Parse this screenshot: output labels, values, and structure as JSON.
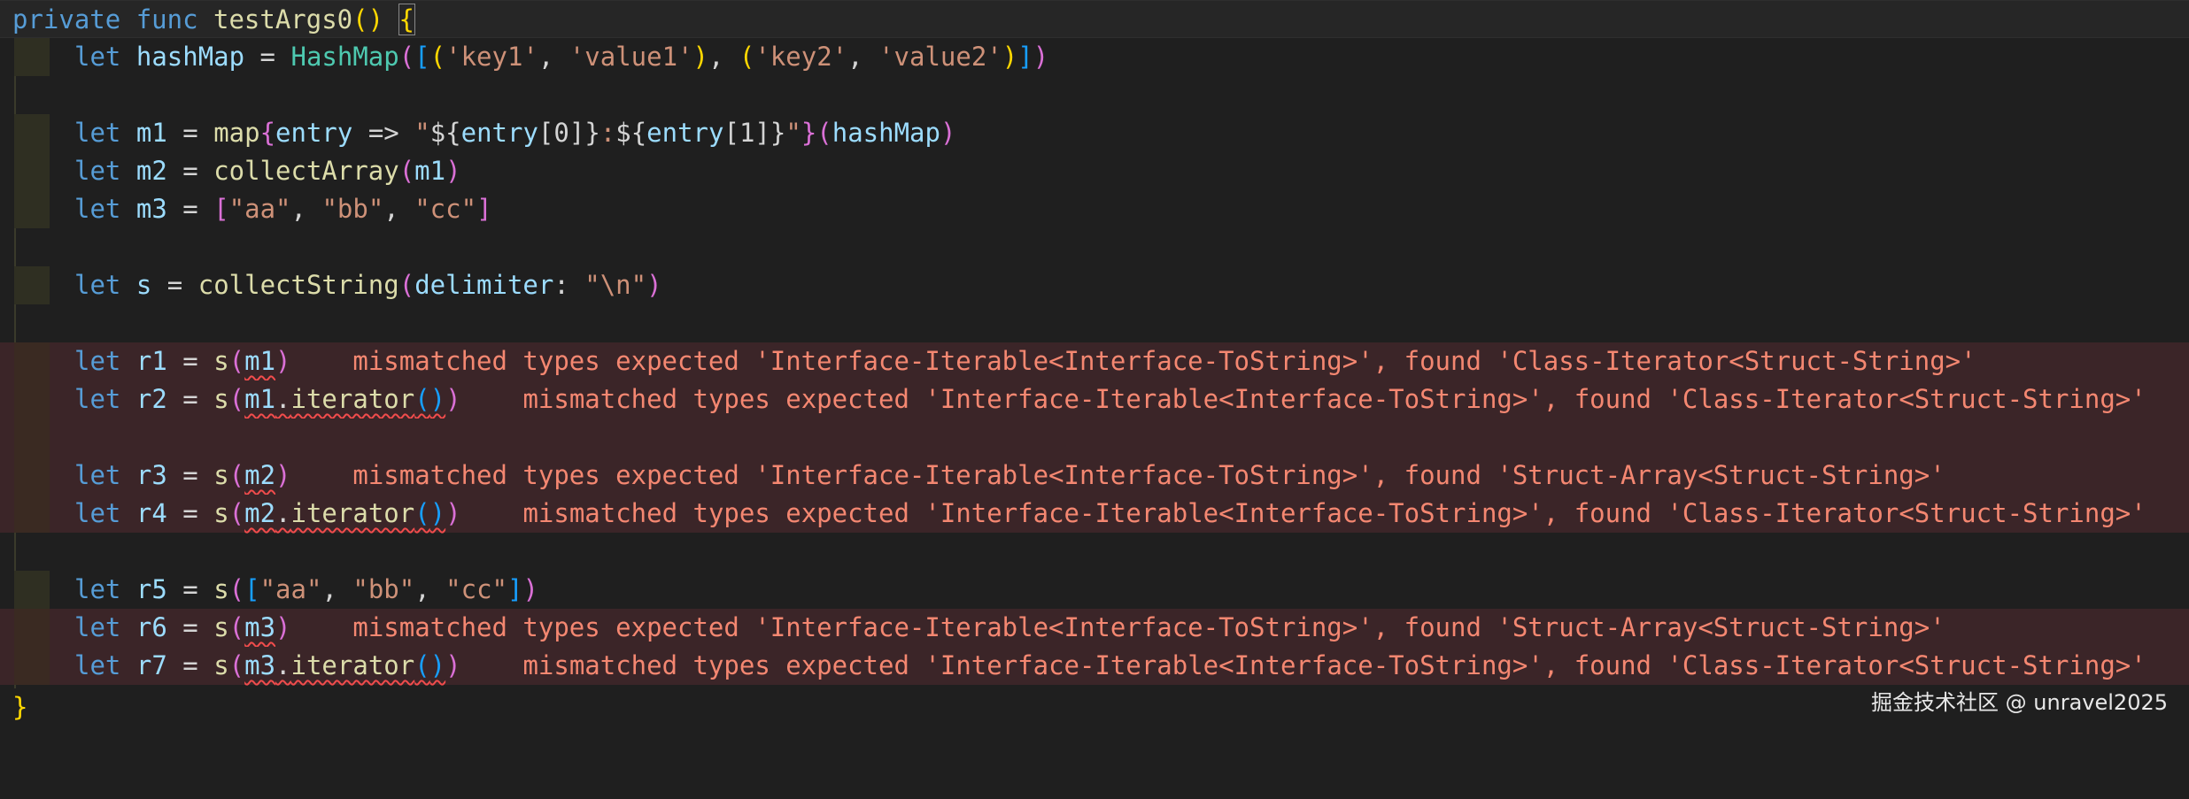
{
  "lines": {
    "l0": {
      "kw1": "private",
      "kw2": "func",
      "name": "testArgs0",
      "parens": "()",
      "brace": "{"
    },
    "l1": {
      "kw": "let",
      "var": "hashMap",
      "eq": "=",
      "type": "HashMap",
      "open": "(",
      "lb": "[",
      "p1o": "(",
      "k1": "'key1'",
      "c1": ",",
      "v1": "'value1'",
      "p1c": ")",
      "c2": ",",
      "p2o": "(",
      "k2": "'key2'",
      "c3": ",",
      "v2": "'value2'",
      "p2c": ")",
      "rb": "]",
      "close": ")"
    },
    "l3": {
      "kw": "let",
      "var": "m1",
      "eq": "=",
      "fn": "map",
      "bo": "{",
      "param": "entry",
      "arrow": "=>",
      "q1": "\"",
      "i1": "${",
      "e1": "entry",
      "a1": "[0]",
      "i1c": "}",
      "colon": ":",
      "i2": "${",
      "e2": "entry",
      "a2": "[1]",
      "i2c": "}",
      "q2": "\"",
      "bc": "}",
      "po": "(",
      "arg": "hashMap",
      "pc": ")"
    },
    "l4": {
      "kw": "let",
      "var": "m2",
      "eq": "=",
      "fn": "collectArray",
      "po": "(",
      "arg": "m1",
      "pc": ")"
    },
    "l5": {
      "kw": "let",
      "var": "m3",
      "eq": "=",
      "lb": "[",
      "s1": "\"aa\"",
      "c1": ",",
      "s2": "\"bb\"",
      "c2": ",",
      "s3": "\"cc\"",
      "rb": "]"
    },
    "l7": {
      "kw": "let",
      "var": "s",
      "eq": "=",
      "fn": "collectString",
      "po": "(",
      "label": "delimiter",
      "colon": ":",
      "str": "\"\\n\"",
      "pc": ")"
    },
    "l9": {
      "kw": "let",
      "var": "r1",
      "eq": "=",
      "fn": "s",
      "po": "(",
      "arg": "m1",
      "pc": ")",
      "error": "mismatched types expected 'Interface-Iterable<Interface-ToString>', found 'Class-Iterator<Struct-String>'"
    },
    "l10": {
      "kw": "let",
      "var": "r2",
      "eq": "=",
      "fn": "s",
      "po": "(",
      "arg": "m1",
      "dot": ".",
      "method": "iterator",
      "mpo": "(",
      "mpc": ")",
      "pc": ")",
      "error": "mismatched types expected 'Interface-Iterable<Interface-ToString>', found 'Class-Iterator<Struct-String>'"
    },
    "l12": {
      "kw": "let",
      "var": "r3",
      "eq": "=",
      "fn": "s",
      "po": "(",
      "arg": "m2",
      "pc": ")",
      "error": "mismatched types expected 'Interface-Iterable<Interface-ToString>', found 'Struct-Array<Struct-String>'"
    },
    "l13": {
      "kw": "let",
      "var": "r4",
      "eq": "=",
      "fn": "s",
      "po": "(",
      "arg": "m2",
      "dot": ".",
      "method": "iterator",
      "mpo": "(",
      "mpc": ")",
      "pc": ")",
      "error": "mismatched types expected 'Interface-Iterable<Interface-ToString>', found 'Class-Iterator<Struct-String>'"
    },
    "l15": {
      "kw": "let",
      "var": "r5",
      "eq": "=",
      "fn": "s",
      "po": "(",
      "lb": "[",
      "s1": "\"aa\"",
      "c1": ",",
      "s2": "\"bb\"",
      "c2": ",",
      "s3": "\"cc\"",
      "rb": "]",
      "pc": ")"
    },
    "l16": {
      "kw": "let",
      "var": "r6",
      "eq": "=",
      "fn": "s",
      "po": "(",
      "arg": "m3",
      "pc": ")",
      "error": "mismatched types expected 'Interface-Iterable<Interface-ToString>', found 'Struct-Array<Struct-String>'"
    },
    "l17": {
      "kw": "let",
      "var": "r7",
      "eq": "=",
      "fn": "s",
      "po": "(",
      "arg": "m3",
      "dot": ".",
      "method": "iterator",
      "mpo": "(",
      "mpc": ")",
      "pc": ")",
      "error": "mismatched types expected 'Interface-Iterable<Interface-ToString>', found 'Class-Iterator<Struct-String>'"
    },
    "l18": {
      "brace": "}"
    }
  },
  "watermark": "掘金技术社区 @ unravel2025",
  "colors": {
    "background": "#1f1f1f",
    "keyword": "#569cd6",
    "function": "#dcdcaa",
    "type": "#4ec9b0",
    "variable": "#9cdcfe",
    "string": "#ce9178",
    "error_text": "#f48771",
    "error_line_bg": "#3b2528"
  }
}
